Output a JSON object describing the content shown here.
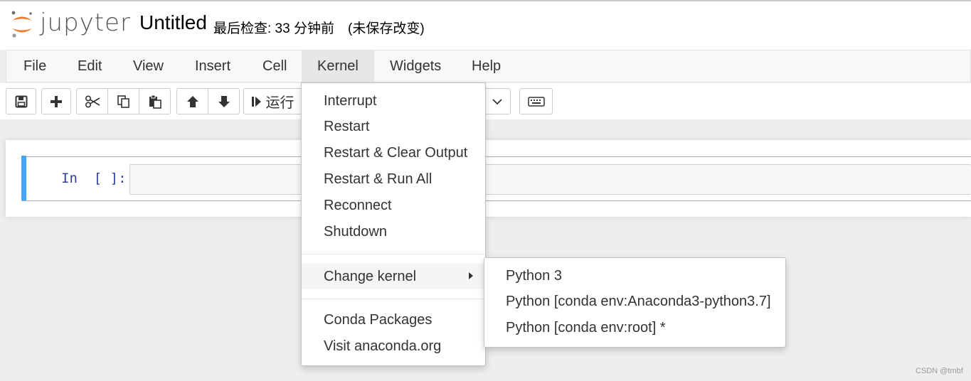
{
  "header": {
    "logo_text": "jupyter",
    "notebook_title": "Untitled",
    "checkpoint": "最后检查: 33 分钟前",
    "save_status": "(未保存改变)"
  },
  "menubar": {
    "items": [
      {
        "label": "File"
      },
      {
        "label": "Edit"
      },
      {
        "label": "View"
      },
      {
        "label": "Insert"
      },
      {
        "label": "Cell"
      },
      {
        "label": "Kernel",
        "active": true
      },
      {
        "label": "Widgets"
      },
      {
        "label": "Help"
      }
    ]
  },
  "toolbar": {
    "icons": [
      "save-icon",
      "plus-icon",
      "scissors-icon",
      "copy-icon",
      "paste-icon",
      "arrow-up-icon",
      "arrow-down-icon",
      "run-icon",
      "chevron-down-icon",
      "keyboard-icon"
    ],
    "run_label": "运行"
  },
  "cell": {
    "prompt": "In  [ ]:"
  },
  "kernel_menu": {
    "items": [
      {
        "label": "Interrupt"
      },
      {
        "label": "Restart"
      },
      {
        "label": "Restart & Clear Output"
      },
      {
        "label": "Restart & Run All"
      },
      {
        "label": "Reconnect"
      },
      {
        "label": "Shutdown"
      },
      {
        "label": "Change kernel",
        "has_submenu": true
      },
      {
        "label": "Conda Packages"
      },
      {
        "label": "Visit anaconda.org"
      }
    ]
  },
  "change_kernel_submenu": {
    "items": [
      {
        "label": "Python 3"
      },
      {
        "label": "Python [conda env:Anaconda3-python3.7]"
      },
      {
        "label": "Python [conda env:root] *"
      }
    ]
  },
  "watermark": "CSDN @tmbf",
  "colors": {
    "jupyter_orange": "#f37726",
    "cell_selected_bar": "#42a5f5",
    "prompt_blue": "#303f9f"
  }
}
